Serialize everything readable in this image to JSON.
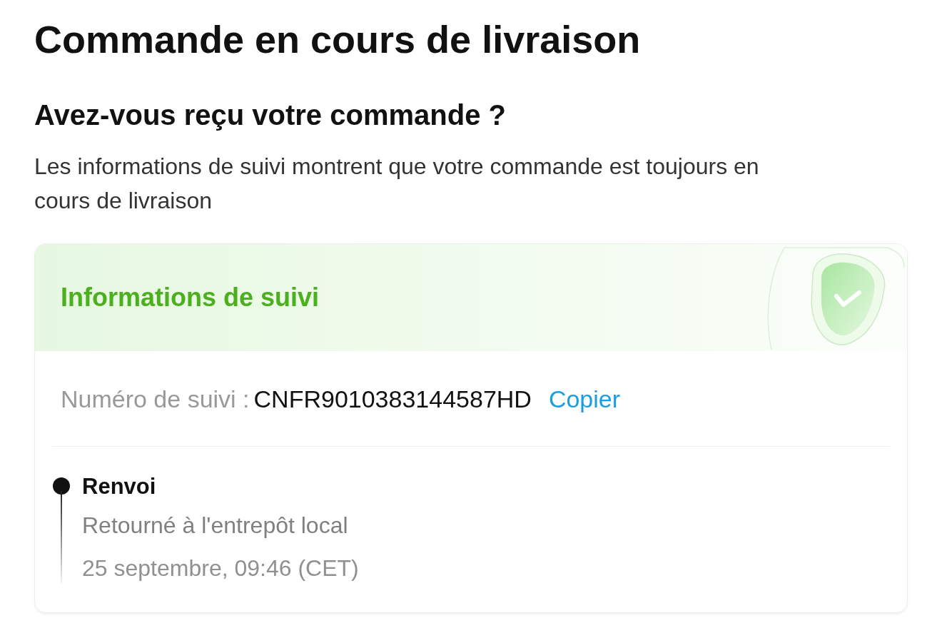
{
  "title": "Commande en cours de livraison",
  "question": "Avez-vous reçu votre commande ?",
  "message": "Les informations de suivi montrent que votre commande est toujours en cours de livraison",
  "tracking_card": {
    "header": "Informations de suivi",
    "tracking_number_label": "Numéro de suivi :",
    "tracking_number": "CNFR9010383144587HD",
    "copy_link": "Copier",
    "events": [
      {
        "status": "Renvoi",
        "description": "Retourné à l'entrepôt local",
        "time": "25 septembre, 09:46 (CET)"
      }
    ]
  }
}
